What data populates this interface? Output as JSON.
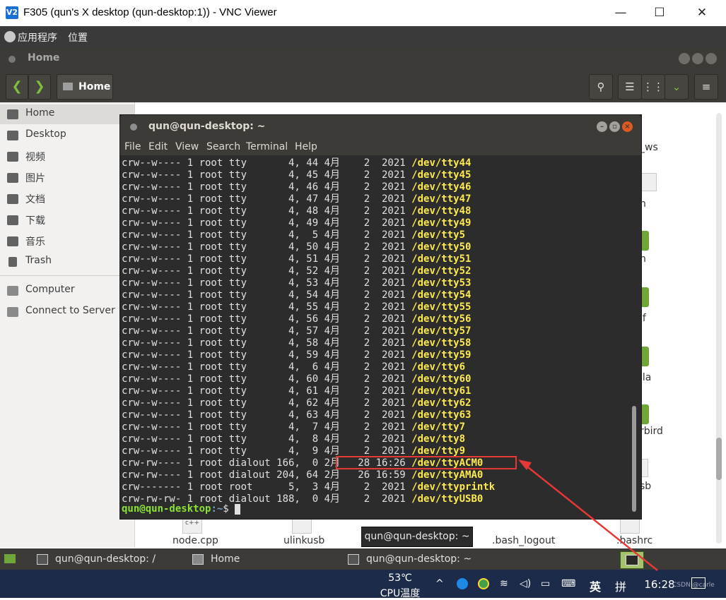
{
  "vnc": {
    "logo": "V2",
    "title": "F305 (qun's X desktop (qun-desktop:1)) - VNC Viewer",
    "minimize": "—",
    "maximize": "☐",
    "close": "✕"
  },
  "top_panel": {
    "menu_apps": "应用程序",
    "menu_places": "位置"
  },
  "nautilus": {
    "window_title": "Home",
    "back": "❮",
    "forward": "❯",
    "location_button": "Home",
    "search": "⚲",
    "list_view": "☰",
    "grid_view": "⋮⋮",
    "view_options": "⌄",
    "menu": "≡"
  },
  "sidebar": {
    "items": [
      {
        "label": "Home"
      },
      {
        "label": "Desktop"
      },
      {
        "label": "视频"
      },
      {
        "label": "图片"
      },
      {
        "label": "文档"
      },
      {
        "label": "下载"
      },
      {
        "label": "音乐"
      },
      {
        "label": "Trash"
      },
      {
        "label": "Computer"
      },
      {
        "label": "Connect to Server"
      }
    ]
  },
  "files": {
    "partial_labels": [
      "_ws",
      "ıf",
      "lla",
      "rbird",
      "sb",
      "n"
    ],
    "bottom_labels": [
      "node.cpp",
      "ulinkusb",
      ".bash_logout",
      ".bashrc"
    ],
    "cpp_badge": "c++"
  },
  "terminal": {
    "title": "qun@qun-desktop: ~",
    "menu": [
      "File",
      "Edit",
      "View",
      "Search",
      "Terminal",
      "Help"
    ],
    "rows": [
      {
        "text": "crw--w---- 1 root tty       4, 44 4月    2  2021 ",
        "dev": "/dev/tty44"
      },
      {
        "text": "crw--w---- 1 root tty       4, 45 4月    2  2021 ",
        "dev": "/dev/tty45"
      },
      {
        "text": "crw--w---- 1 root tty       4, 46 4月    2  2021 ",
        "dev": "/dev/tty46"
      },
      {
        "text": "crw--w---- 1 root tty       4, 47 4月    2  2021 ",
        "dev": "/dev/tty47"
      },
      {
        "text": "crw--w---- 1 root tty       4, 48 4月    2  2021 ",
        "dev": "/dev/tty48"
      },
      {
        "text": "crw--w---- 1 root tty       4, 49 4月    2  2021 ",
        "dev": "/dev/tty49"
      },
      {
        "text": "crw--w---- 1 root tty       4,  5 4月    2  2021 ",
        "dev": "/dev/tty5"
      },
      {
        "text": "crw--w---- 1 root tty       4, 50 4月    2  2021 ",
        "dev": "/dev/tty50"
      },
      {
        "text": "crw--w---- 1 root tty       4, 51 4月    2  2021 ",
        "dev": "/dev/tty51"
      },
      {
        "text": "crw--w---- 1 root tty       4, 52 4月    2  2021 ",
        "dev": "/dev/tty52"
      },
      {
        "text": "crw--w---- 1 root tty       4, 53 4月    2  2021 ",
        "dev": "/dev/tty53"
      },
      {
        "text": "crw--w---- 1 root tty       4, 54 4月    2  2021 ",
        "dev": "/dev/tty54"
      },
      {
        "text": "crw--w---- 1 root tty       4, 55 4月    2  2021 ",
        "dev": "/dev/tty55"
      },
      {
        "text": "crw--w---- 1 root tty       4, 56 4月    2  2021 ",
        "dev": "/dev/tty56"
      },
      {
        "text": "crw--w---- 1 root tty       4, 57 4月    2  2021 ",
        "dev": "/dev/tty57"
      },
      {
        "text": "crw--w---- 1 root tty       4, 58 4月    2  2021 ",
        "dev": "/dev/tty58"
      },
      {
        "text": "crw--w---- 1 root tty       4, 59 4月    2  2021 ",
        "dev": "/dev/tty59"
      },
      {
        "text": "crw--w---- 1 root tty       4,  6 4月    2  2021 ",
        "dev": "/dev/tty6"
      },
      {
        "text": "crw--w---- 1 root tty       4, 60 4月    2  2021 ",
        "dev": "/dev/tty60"
      },
      {
        "text": "crw--w---- 1 root tty       4, 61 4月    2  2021 ",
        "dev": "/dev/tty61"
      },
      {
        "text": "crw--w---- 1 root tty       4, 62 4月    2  2021 ",
        "dev": "/dev/tty62"
      },
      {
        "text": "crw--w---- 1 root tty       4, 63 4月    2  2021 ",
        "dev": "/dev/tty63"
      },
      {
        "text": "crw--w---- 1 root tty       4,  7 4月    2  2021 ",
        "dev": "/dev/tty7"
      },
      {
        "text": "crw--w---- 1 root tty       4,  8 4月    2  2021 ",
        "dev": "/dev/tty8"
      },
      {
        "text": "crw--w---- 1 root tty       4,  9 4月    2  2021 ",
        "dev": "/dev/tty9"
      },
      {
        "text": "crw-rw---- 1 root dialout 166,  0 2月   28 16:26 ",
        "dev": "/dev/ttyACM0"
      },
      {
        "text": "crw-rw---- 1 root dialout 204, 64 2月   26 16:59 ",
        "dev": "/dev/ttyAMA0"
      },
      {
        "text": "crw------- 1 root root      5,  3 4月    2  2021 ",
        "dev": "/dev/ttyprintk"
      },
      {
        "text": "crw-rw-rw- 1 root dialout 188,  0 4月    2  2021 ",
        "dev": "/dev/ttyUSB0"
      }
    ],
    "prompt_user": "qun@qun-desktop",
    "prompt_path": ":~",
    "prompt_symbol": "$ "
  },
  "tooltip": "qun@qun-desktop: ~",
  "ubuntu_taskbar": {
    "tasks": [
      {
        "label": "qun@qun-desktop: /"
      },
      {
        "label": "Home"
      },
      {
        "label": "qun@qun-desktop: ~"
      }
    ]
  },
  "windows_taskbar": {
    "temp": "53℃",
    "temp_label": "CPU温度",
    "chevron": "^",
    "lang_en": "英",
    "ime": "拼",
    "time": "16:28",
    "watermark": "CSDN @carle"
  }
}
